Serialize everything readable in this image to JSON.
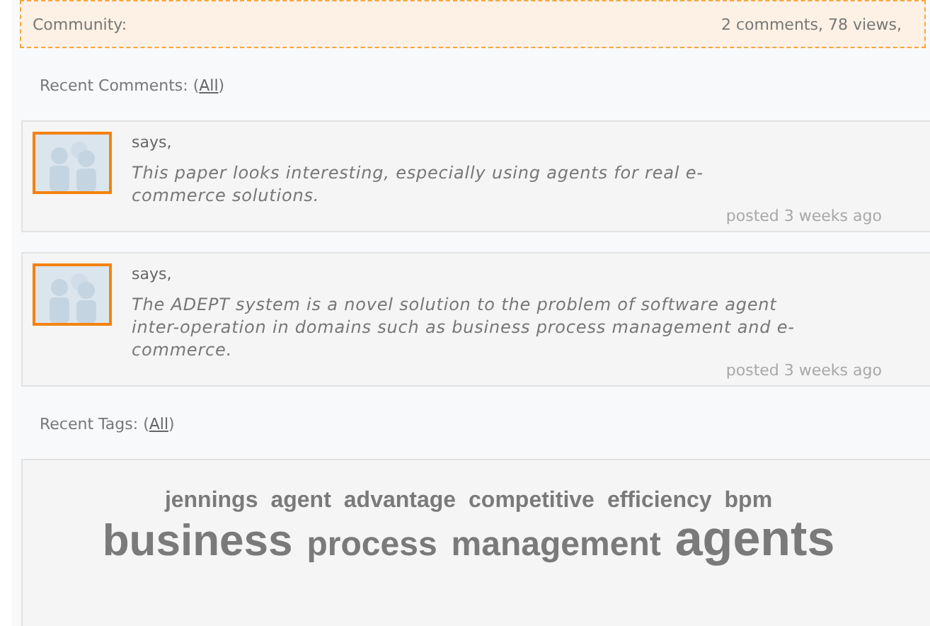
{
  "community": {
    "label": "Community:",
    "stats": "2 comments, 78 views,"
  },
  "recent_comments": {
    "label": "Recent Comments:",
    "open": "(",
    "link": "All",
    "close": ")"
  },
  "comments": [
    {
      "says": "says,",
      "text": "This paper looks interesting, especially using agents for real e-commerce solutions.",
      "posted": "posted 3 weeks ago"
    },
    {
      "says": "says,",
      "text": "The ADEPT system is a novel solution to the problem of software agent inter-operation in domains such as business process management and e-commerce.",
      "posted": "posted 3 weeks ago"
    }
  ],
  "recent_tags": {
    "label": "Recent Tags:",
    "open": "(",
    "link": "All",
    "close": ")"
  },
  "tags": [
    {
      "label": "jennings",
      "kind": "small"
    },
    {
      "label": "agent",
      "kind": "small"
    },
    {
      "label": "advantage",
      "kind": "small"
    },
    {
      "label": "competitive",
      "kind": "small"
    },
    {
      "label": "efficiency",
      "kind": "small"
    },
    {
      "label": "bpm",
      "kind": "small"
    },
    {
      "label": "business",
      "kind": "large"
    },
    {
      "label": "process",
      "kind": "medium"
    },
    {
      "label": "management",
      "kind": "medium"
    },
    {
      "label": "agents",
      "kind": "largest"
    }
  ]
}
